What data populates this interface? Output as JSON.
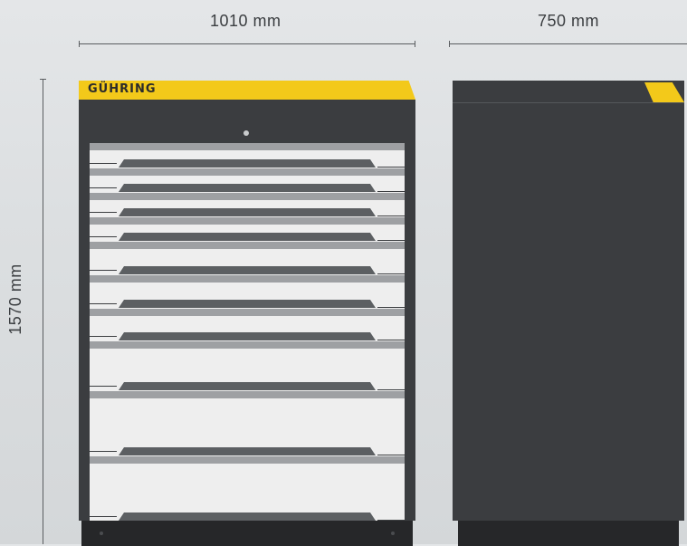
{
  "dimensions": {
    "width_label": "1010 mm",
    "depth_label": "750 mm",
    "height_label": "1570 mm"
  },
  "cabinet": {
    "brand": "GÜHRING",
    "drawer_count": 10
  },
  "colors": {
    "brand_yellow": "#f3c91a",
    "cabinet_body": "#3b3d40",
    "drawer_front": "#eeeeee"
  }
}
